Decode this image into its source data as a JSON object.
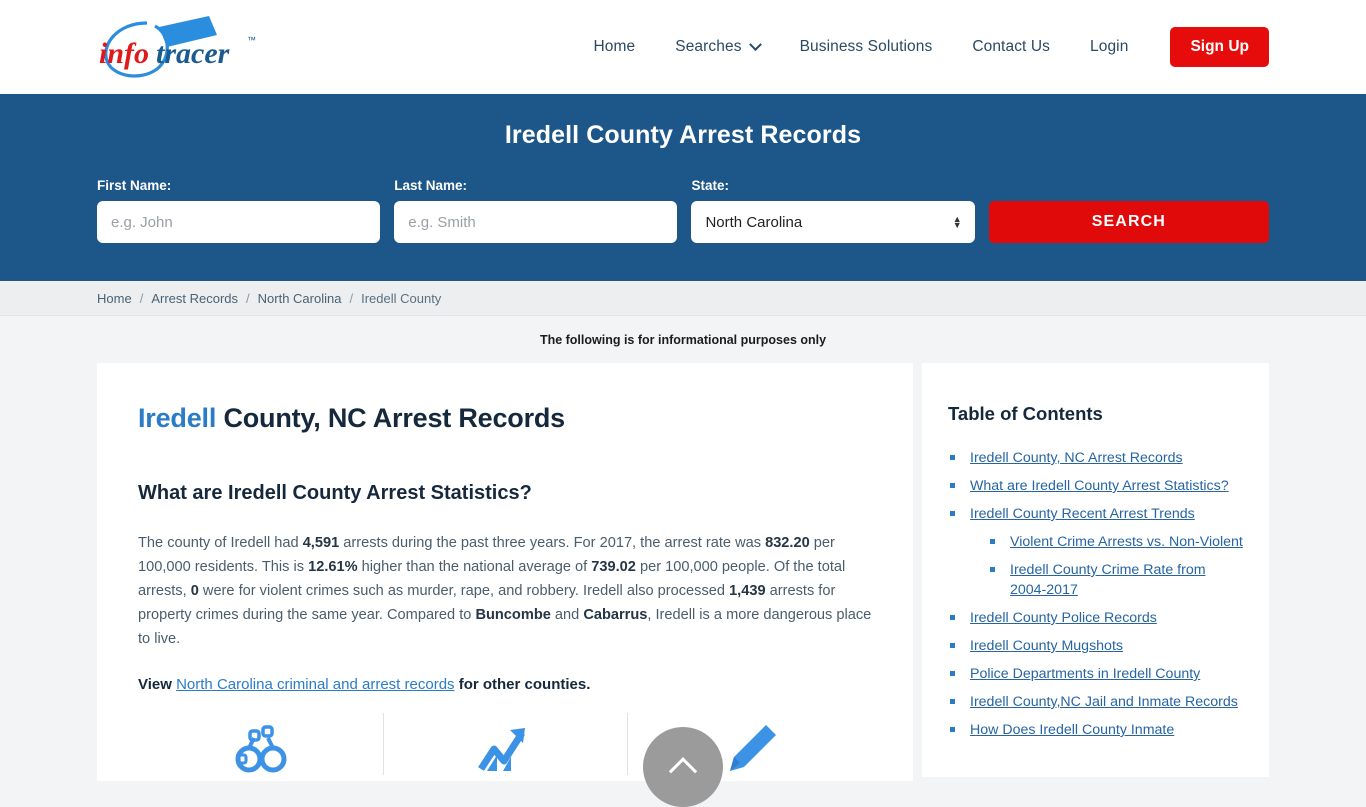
{
  "header": {
    "logo_text_info": "info",
    "logo_text_tracer": "tracer",
    "logo_tm": "™",
    "nav": [
      {
        "label": "Home",
        "icon": null
      },
      {
        "label": "Searches",
        "icon": "chevron-down-icon"
      },
      {
        "label": "Business Solutions",
        "icon": null
      },
      {
        "label": "Contact Us",
        "icon": null
      },
      {
        "label": "Login",
        "icon": null
      }
    ],
    "signup_label": "Sign Up",
    "signup_color": "#e60c0c"
  },
  "banner": {
    "title": "Iredell County Arrest Records",
    "background_color": "#1d5789",
    "first_name_label": "First Name:",
    "first_name_placeholder": "e.g. John",
    "first_name_value": "",
    "last_name_label": "Last Name:",
    "last_name_placeholder": "e.g. Smith",
    "last_name_value": "",
    "state_label": "State:",
    "state_selected": "North Carolina",
    "state_options": [
      "North Carolina"
    ],
    "search_label": "SEARCH",
    "search_color": "#e00a0a"
  },
  "breadcrumb": {
    "items": [
      "Home",
      "Arrest Records",
      "North Carolina",
      "Iredell County"
    ],
    "separator": "/"
  },
  "disclaimer": "The following is for informational purposes only",
  "main": {
    "title_highlight": "Iredell",
    "title_rest": " County, NC Arrest Records",
    "subtitle": "What are Iredell County Arrest Statistics?",
    "paragraph": {
      "p1": "The county of Iredell had ",
      "b1": "4,591",
      "p2": " arrests during the past three years. For 2017, the arrest rate was ",
      "b2": "832.20",
      "p3": " per 100,000 residents. This is ",
      "b3": "12.61%",
      "p4": " higher than the national average of ",
      "b4": "739.02",
      "p5": " per 100,000 people. Of the total arrests, ",
      "b5": "0",
      "p6": " were for violent crimes such as murder, rape, and robbery. Iredell also processed ",
      "b6": "1,439",
      "p7": " arrests for property crimes during the same year. Compared to ",
      "b7": "Buncombe",
      "p8": " and ",
      "b8": "Cabarrus",
      "p9": ", Iredell is a more dangerous place to live."
    },
    "view_prefix": "View ",
    "view_link": "North Carolina criminal and arrest records",
    "view_suffix": " for other counties.",
    "icons": [
      "handcuffs-icon",
      "trending-up-icon",
      "pen-icon"
    ],
    "icon_color": "#3c92e5"
  },
  "toc": {
    "title": "Table of Contents",
    "items": [
      {
        "label": "Iredell County, NC Arrest Records",
        "children": []
      },
      {
        "label": "What are Iredell County Arrest Statistics?",
        "children": []
      },
      {
        "label": "Iredell County Recent Arrest Trends",
        "children": [
          {
            "label": "Violent Crime Arrests vs. Non-Violent"
          },
          {
            "label": "Iredell County Crime Rate from 2004-2017"
          }
        ]
      },
      {
        "label": "Iredell County Police Records",
        "children": []
      },
      {
        "label": "Iredell County Mugshots",
        "children": []
      },
      {
        "label": "Police Departments in Iredell County",
        "children": []
      },
      {
        "label": "Iredell County,NC Jail and Inmate Records",
        "children": []
      },
      {
        "label": "How Does Iredell County Inmate",
        "children": []
      }
    ]
  },
  "scroll_top": {
    "icon": "chevron-up-icon",
    "color": "#9b9b9b"
  }
}
